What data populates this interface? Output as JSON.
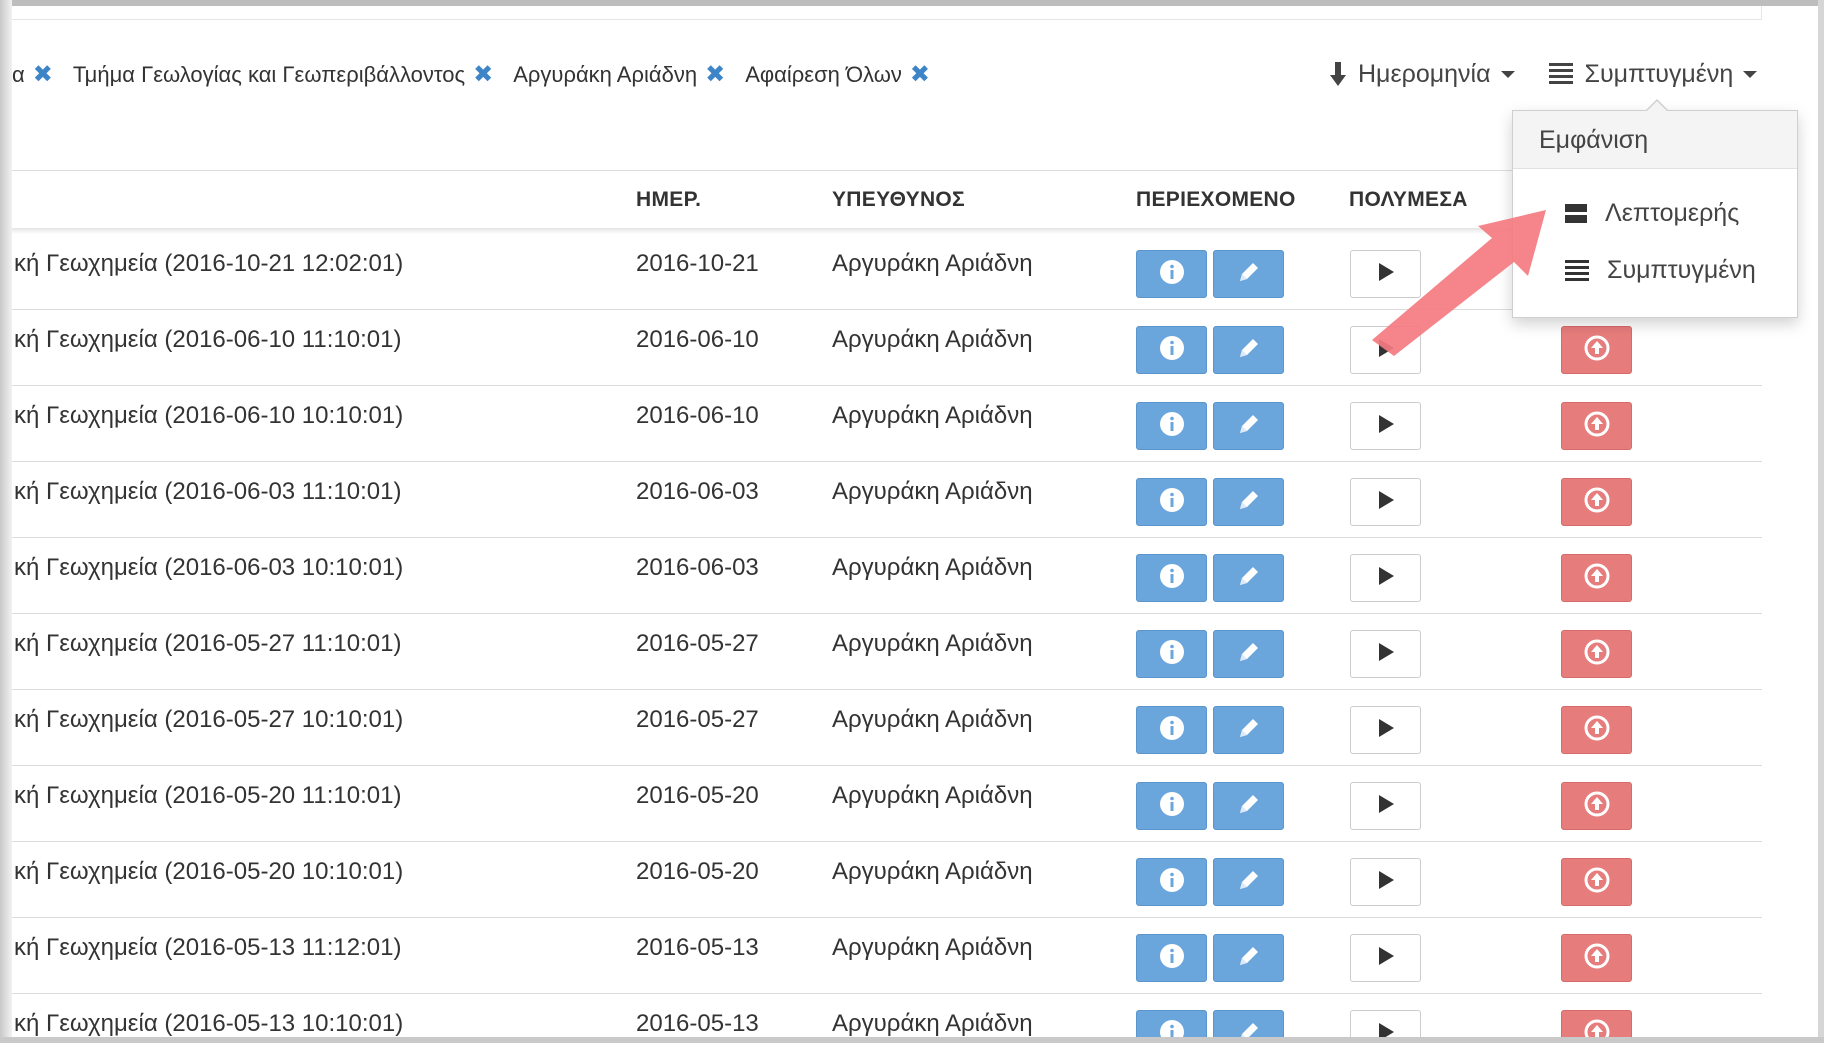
{
  "filters": {
    "chips": [
      {
        "label": "α"
      },
      {
        "label": "Τμήμα Γεωλογίας και Γεωπεριβάλλοντος"
      },
      {
        "label": "Αργυράκη Αριάδνη"
      },
      {
        "label": "Αφαίρεση Όλων"
      }
    ],
    "remove_glyph": "✖"
  },
  "controls": {
    "sort_label": "Ημερομηνία",
    "view_label": "Συμπτυγμένη"
  },
  "dropdown": {
    "header": "Εμφάνιση",
    "items": [
      {
        "label": "Λεπτομερής",
        "icon": "detailed-view-icon"
      },
      {
        "label": "Συμπτυγμένη",
        "icon": "list-icon"
      }
    ]
  },
  "table": {
    "headers": {
      "date": "ΗΜΕΡ.",
      "owner": "ΥΠΕΥΘΥΝΟΣ",
      "content": "ΠΕΡΙΕΧΟΜΕΝΟ",
      "media": "ΠΟΛΥΜΕΣΑ"
    },
    "rows": [
      {
        "title": "κή Γεωχημεία (2016-10-21 12:02:01)",
        "date": "2016-10-21",
        "owner": "Αργυράκη Αριάδνη"
      },
      {
        "title": "κή Γεωχημεία (2016-06-10 11:10:01)",
        "date": "2016-06-10",
        "owner": "Αργυράκη Αριάδνη"
      },
      {
        "title": "κή Γεωχημεία (2016-06-10 10:10:01)",
        "date": "2016-06-10",
        "owner": "Αργυράκη Αριάδνη"
      },
      {
        "title": "κή Γεωχημεία (2016-06-03 11:10:01)",
        "date": "2016-06-03",
        "owner": "Αργυράκη Αριάδνη"
      },
      {
        "title": "κή Γεωχημεία (2016-06-03 10:10:01)",
        "date": "2016-06-03",
        "owner": "Αργυράκη Αριάδνη"
      },
      {
        "title": "κή Γεωχημεία (2016-05-27 11:10:01)",
        "date": "2016-05-27",
        "owner": "Αργυράκη Αριάδνη"
      },
      {
        "title": "κή Γεωχημεία (2016-05-27 10:10:01)",
        "date": "2016-05-27",
        "owner": "Αργυράκη Αριάδνη"
      },
      {
        "title": "κή Γεωχημεία (2016-05-20 11:10:01)",
        "date": "2016-05-20",
        "owner": "Αργυράκη Αριάδνη"
      },
      {
        "title": "κή Γεωχημεία (2016-05-20 10:10:01)",
        "date": "2016-05-20",
        "owner": "Αργυράκη Αριάδνη"
      },
      {
        "title": "κή Γεωχημεία (2016-05-13 11:12:01)",
        "date": "2016-05-13",
        "owner": "Αργυράκη Αριάδνη"
      },
      {
        "title": "κή Γεωχημεία (2016-05-13 10:10:01)",
        "date": "2016-05-13",
        "owner": "Αργυράκη Αριάδνη"
      }
    ],
    "row_icons": [
      "info-icon",
      "pencil-icon",
      "play-icon",
      "upload-icon"
    ]
  },
  "colors": {
    "primary": "#6aa5dc",
    "danger": "#e77c7c",
    "remove_x": "#3e85c7",
    "annotation_arrow": "#f47b80"
  }
}
